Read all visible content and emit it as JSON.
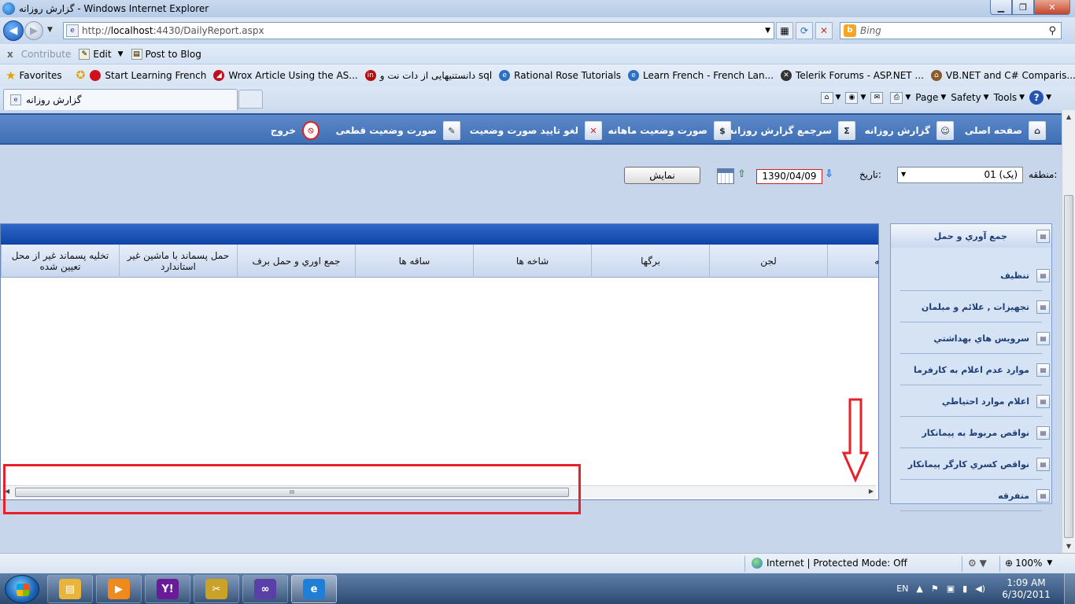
{
  "window": {
    "title": "گزارش روزانه - Windows Internet Explorer",
    "controls": {
      "minimize": "▁",
      "maximize": "❐",
      "close": "✕"
    }
  },
  "address_bar": {
    "url_prefix": "http://",
    "url_host": "localhost",
    "url_rest": ":4430/DailyReport.aspx",
    "search_placeholder": "Bing"
  },
  "command_bar": {
    "close_x": "x",
    "items": [
      {
        "label": "Contribute",
        "disabled": true
      },
      {
        "label": "Edit",
        "disabled": false
      },
      {
        "label": "Post to Blog",
        "disabled": false
      }
    ]
  },
  "favorites_bar": {
    "favorites_label": "Favorites",
    "links": [
      {
        "label": "Start Learning French",
        "icon": "red-circle-icon",
        "color": "#d0101a"
      },
      {
        "label": "Wrox Article  Using the AS...",
        "icon": "wrox-icon",
        "color": "#c01020"
      },
      {
        "label": "دانستنیهایی از دات نت و sql",
        "icon": "in-icon",
        "color": "#b01010"
      },
      {
        "label": "Rational Rose Tutorials",
        "icon": "ie-page-icon",
        "color": "#2d6fc0"
      },
      {
        "label": "Learn French - French Lan...",
        "icon": "ie-page-icon",
        "color": "#2d6fc0"
      },
      {
        "label": "Telerik Forums - ASP.NET ...",
        "icon": "telerik-icon",
        "color": "#333333"
      },
      {
        "label": "VB.NET and C# Comparis...",
        "icon": "house-icon",
        "color": "#8a5a2b"
      }
    ]
  },
  "tabs": {
    "active_tab_label": "گزارش روزانه",
    "tools": {
      "page": "Page",
      "safety": "Safety",
      "tools": "Tools",
      "help": "?"
    }
  },
  "menu": {
    "items": [
      {
        "label": "صفحه اصلی",
        "icon": "home-icon"
      },
      {
        "label": "گزارش روزانه",
        "icon": "person-report-icon"
      },
      {
        "label": "سرجمع گزارش روزانه",
        "icon": "sigma-icon"
      },
      {
        "label": "صورت وضعیت ماهانه",
        "icon": "document-money-icon"
      },
      {
        "label": "لغو تایید صورت وضعیت",
        "icon": "document-cancel-icon"
      },
      {
        "label": "صورت وضعیت قطعی",
        "icon": "document-edit-icon"
      },
      {
        "label": "خروج",
        "icon": "exit-icon"
      }
    ]
  },
  "filters": {
    "region_label": "منطقه:",
    "region_value": "01 (یک)",
    "date_label": "تاریخ:",
    "date_value": "1390/04/09",
    "show_button": "نمایش"
  },
  "sidebar": {
    "items": [
      {
        "label": "جمع آوري و حمل",
        "active": true
      },
      {
        "label": "تنظيف",
        "active": false
      },
      {
        "label": "تجهيزات , علائم و مبلمان",
        "active": false
      },
      {
        "label": "سرويس هاي بهداشتي",
        "active": false
      },
      {
        "label": "موارد عدم اعلام به كارفرما",
        "active": false
      },
      {
        "label": "اعلام موارد احتياطي",
        "active": false
      },
      {
        "label": "نواقص مربوط به پيمانكار",
        "active": false
      },
      {
        "label": "نواقص كسري كارگر پيمانكار",
        "active": false
      },
      {
        "label": "متفرقه",
        "active": false
      }
    ]
  },
  "grid": {
    "columns": [
      "تخليه پسماند غير از محل تعيين شده",
      "حمل پسماند با ماشين غير استاندارد",
      "جمع اوري و حمل برف",
      "ساقه ها",
      "شاخه ها",
      "برگها",
      "لجن",
      "به"
    ],
    "scroll_grip": "III"
  },
  "status_bar": {
    "zone_text": "Internet | Protected Mode: Off",
    "zoom": "100%"
  },
  "taskbar": {
    "apps": [
      {
        "name": "explorer",
        "icon": "folder-icon",
        "color": "#e8b53a"
      },
      {
        "name": "media-player",
        "icon": "media-player-icon",
        "color": "#f08a1c"
      },
      {
        "name": "yahoo-messenger",
        "icon": "yahoo-icon",
        "color": "#6a1b9a"
      },
      {
        "name": "tools",
        "icon": "tools-icon",
        "color": "#c9a227"
      },
      {
        "name": "visual-studio",
        "icon": "visual-studio-icon",
        "color": "#5b3fa8"
      },
      {
        "name": "internet-explorer",
        "icon": "ie-icon",
        "color": "#1f7fd6"
      }
    ],
    "language": "EN",
    "time": "1:09 AM",
    "date": "6/30/2011"
  }
}
